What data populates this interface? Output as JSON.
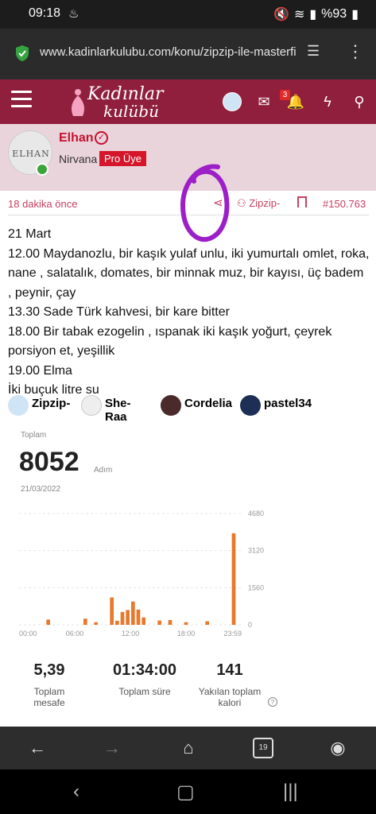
{
  "status_bar": {
    "time": "09:18",
    "battery": "%93"
  },
  "browser": {
    "url": "www.kadinlarkulubu.com/konu/zipzip-ile-masterfi"
  },
  "site": {
    "logo_line1": "Kadınlar",
    "logo_line2": "kulübü",
    "notif_count": "3",
    "brand_color": "#8f1f3d"
  },
  "post": {
    "author": "Elhan",
    "avatar_text": "ELHAN",
    "rank": "Nirvana",
    "badge": "Pro Üye",
    "time": "18 dakika önce",
    "quoted_user": "Zipzip-",
    "post_number": "#150.763",
    "lines": [
      "21 Mart",
      "12.00 Maydanozlu, bir kaşık yulaf unlu, iki yumurtalı omlet, roka, nane , salatalık, domates, bir minnak muz, bir kayısı, üç badem , peynir, çay",
      "13.30 Sade Türk kahvesi, bir kare bitter",
      "18.00 Bir tabak ezogelin , ıspanak iki kaşık yoğurt, çeyrek porsiyon et, yeşillik",
      "19.00 Elma",
      "İki buçuk litre su"
    ]
  },
  "reactions": [
    {
      "name": "Zipzip-",
      "color": "#c8102e"
    },
    {
      "name": "She-Raa",
      "color": "#e39a1a"
    },
    {
      "name": "Cordelia",
      "color": "#c8102e"
    },
    {
      "name": "pastel34",
      "color": "#c8102e"
    }
  ],
  "health": {
    "label": "Toplam",
    "steps": "8052",
    "unit": "Adım",
    "date": "21/03/2022",
    "stats": [
      {
        "value": "5,39",
        "label": "Toplam mesafe"
      },
      {
        "value": "01:34:00",
        "label": "Toplam süre"
      },
      {
        "value": "141",
        "label": "Yakılan toplam kalori"
      }
    ]
  },
  "chart_data": {
    "type": "bar",
    "x_tick_labels": [
      "00:00",
      "06:00",
      "12:00",
      "18:00",
      "23:59"
    ],
    "y_tick_labels": [
      "4680",
      "3120",
      "1560",
      "0"
    ],
    "ylim": [
      0,
      4680
    ],
    "bar_color": "#e8782b",
    "values": [
      {
        "h": 5,
        "v": 220
      },
      {
        "h": 12,
        "v": 260
      },
      {
        "h": 14,
        "v": 110
      },
      {
        "h": 17,
        "v": 1150
      },
      {
        "h": 18,
        "v": 170
      },
      {
        "h": 19,
        "v": 540
      },
      {
        "h": 20,
        "v": 620
      },
      {
        "h": 21,
        "v": 980
      },
      {
        "h": 22,
        "v": 640
      },
      {
        "h": 23,
        "v": 310
      },
      {
        "h": 26,
        "v": 180
      },
      {
        "h": 28,
        "v": 200
      },
      {
        "h": 31,
        "v": 110
      },
      {
        "h": 35,
        "v": 150
      },
      {
        "h": 40,
        "v": 3850
      }
    ]
  }
}
